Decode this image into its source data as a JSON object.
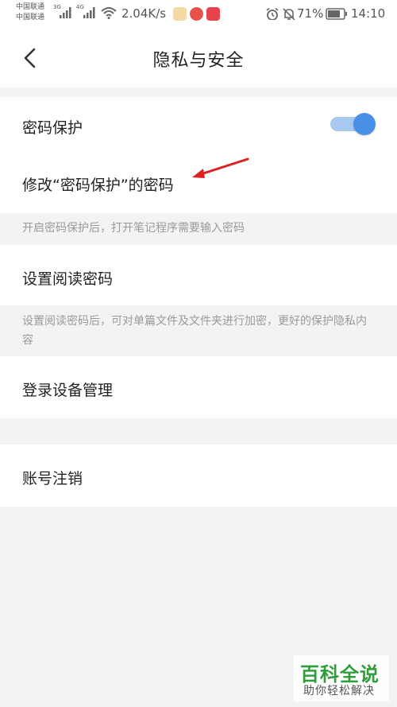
{
  "status_bar": {
    "carrier_top": "中国联通",
    "carrier_bottom": "中国联通",
    "net_tag_1": "3G",
    "net_tag_2": "4G",
    "speed": "2.04K/s",
    "battery": "71%",
    "time": "14:10"
  },
  "header": {
    "title": "隐私与安全"
  },
  "settings": {
    "password_protect_label": "密码保护",
    "password_protect_on": true,
    "change_password_label": "修改“密码保护”的密码",
    "password_hint": "开启密码保护后，打开笔记程序需要输入密码",
    "reading_password_label": "设置阅读密码",
    "reading_hint": "设置阅读密码后，可对单篇文件及文件夹进行加密，更好的保护隐私内容",
    "device_manage_label": "登录设备管理",
    "account_cancel_label": "账号注销"
  },
  "colors": {
    "accent": "#4a8fe7",
    "annotation_arrow": "#e02020",
    "watermark": "#2f9e3a"
  },
  "watermark": {
    "main": "百科全说",
    "sub": "助你轻松解决"
  }
}
